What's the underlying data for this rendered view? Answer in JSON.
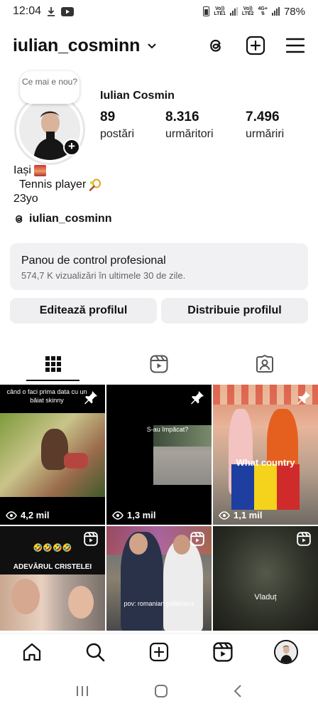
{
  "status_bar": {
    "time": "12:04",
    "sim1_top": "Vo))",
    "sim1_bottom": "LTE1",
    "sim2_top": "Vo))",
    "sim2_bottom": "LTE2",
    "sim2_net_top": "4G+",
    "battery": "78%"
  },
  "header": {
    "username": "iulian_cosminn",
    "icons": [
      "threads-icon",
      "add-post-icon",
      "menu-icon"
    ]
  },
  "profile": {
    "note": "Ce mai e nou?",
    "full_name": "Iulian Cosmin",
    "posts_count": "89",
    "posts_label": "postări",
    "followers_count": "8.316",
    "followers_label": "urmăritori",
    "following_count": "7.496",
    "following_label": "urmăriri",
    "bio_line1": "Iași",
    "bio_line2": "Tennis player",
    "bio_line3": "23yo",
    "threads_handle": "iulian_cosminn"
  },
  "pro_panel": {
    "title": "Panou de control profesional",
    "subtitle": "574,7 K vizualizări în ultimele 30 de zile."
  },
  "buttons": {
    "edit": "Editează profilul",
    "share": "Distribuie profilul"
  },
  "tabs": [
    "grid-icon",
    "reels-tab-icon",
    "tagged-icon"
  ],
  "grid": [
    {
      "caption": "când o faci prima data cu un băiat skinny",
      "views": "4,2 mil",
      "badge": "pin-icon"
    },
    {
      "caption": "S-au împăcat?",
      "views": "1,3 mil",
      "badge": "pin-icon"
    },
    {
      "caption": "What country",
      "views": "1,1 mil",
      "badge": "pin-icon"
    },
    {
      "caption": "ADEVĂRUL CRISTELEI",
      "emoji_caption": "🤣🤣🤣🤣",
      "badge": "reel-icon"
    },
    {
      "caption": "pov: romanian politicians",
      "badge": "reel-icon"
    },
    {
      "caption": "Vladuț",
      "badge": "reel-icon"
    }
  ],
  "bottom_nav": [
    "home-icon",
    "search-icon",
    "create-icon",
    "reels-icon",
    "profile-avatar"
  ],
  "colors": {
    "panel_bg": "#f1f1f3",
    "button_bg": "#efeff1",
    "text": "#111111",
    "muted": "#666666"
  }
}
